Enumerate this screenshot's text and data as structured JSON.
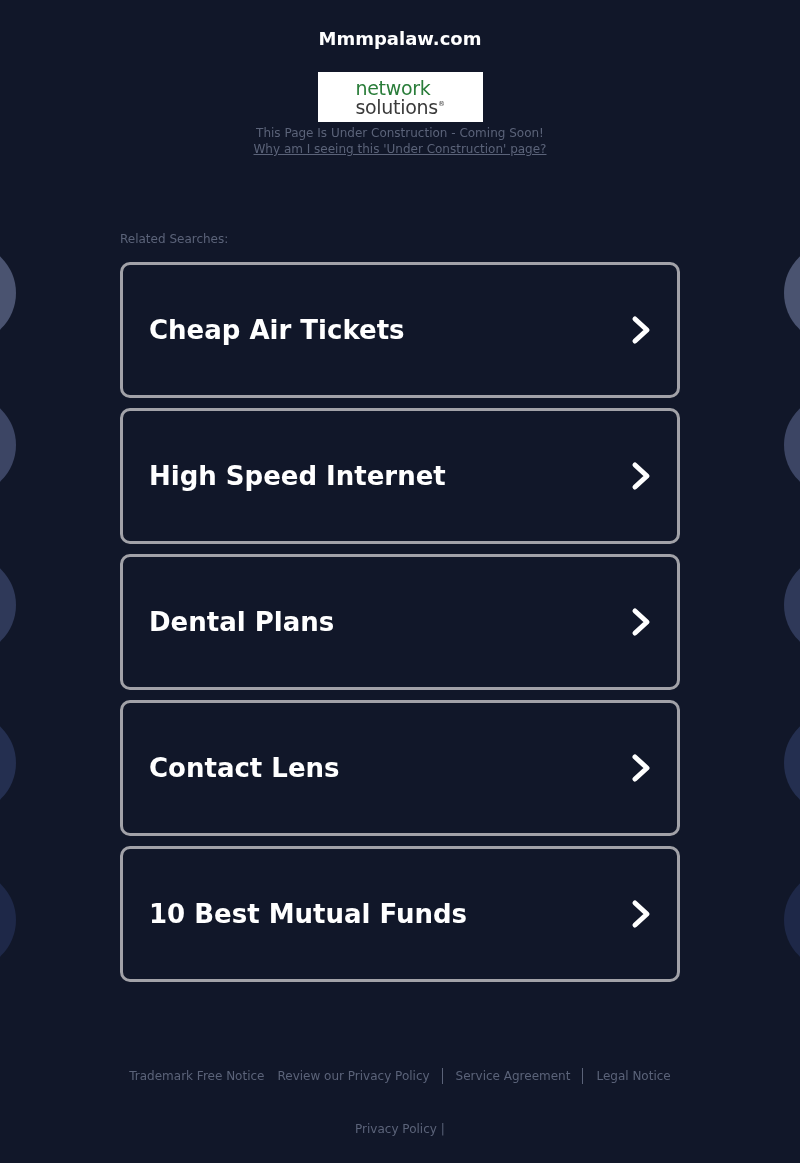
{
  "header": {
    "title": "Mmmpalaw.com",
    "logo": {
      "line_1": "network",
      "line_2": "solutions$^{®}$"
    },
    "notice": "This Page Is Under Construction - Coming Soon!",
    "notice_link": "Why am I seeing this 'Under Construction' page?"
  },
  "related": {
    "label": "Related Searches:",
    "items": [
      "Cheap Air Tickets",
      "High Speed Internet",
      "Dental Plans",
      "Contact Lens",
      "10 Best Mutual Funds"
    ]
  },
  "footer": {
    "links": [
      {
        "label": "Trademark Free Notice",
        "divider_after": false
      },
      {
        "label": "Review our Privacy Policy",
        "divider_after": true
      },
      {
        "label": "Service Agreement",
        "divider_after": true
      },
      {
        "label": "Legal Notice",
        "divider_after": false
      }
    ],
    "bottom_link": "Privacy Policy",
    "bottom_separator": "|"
  }
}
